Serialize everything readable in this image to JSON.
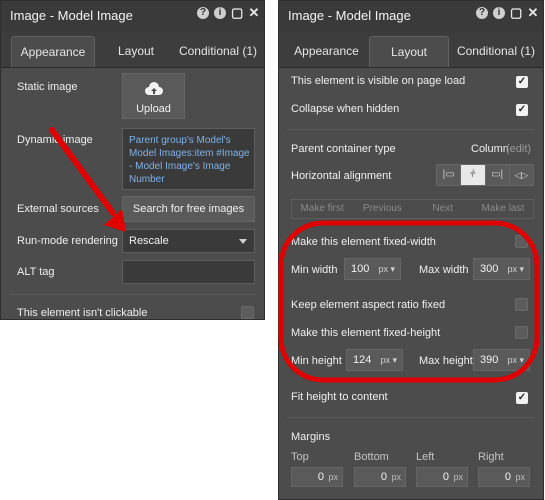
{
  "left": {
    "title": "Image - Model Image",
    "tabs": [
      "Appearance",
      "Layout",
      "Conditional (1)"
    ],
    "static_image_label": "Static image",
    "upload_label": "Upload",
    "dynamic_image_label": "Dynamic image",
    "dynamic_image_value": "Parent group's Model's Model Images:item #Image - Model Image's Image Number",
    "external_sources_label": "External sources",
    "search_button": "Search for free images",
    "runmode_label": "Run-mode rendering",
    "runmode_value": "Rescale",
    "alt_label": "ALT tag",
    "clickable_label": "This element isn't clickable"
  },
  "right": {
    "title": "Image - Model Image",
    "tabs": [
      "Appearance",
      "Layout",
      "Conditional (1)"
    ],
    "visible_label": "This element is visible on page load",
    "collapse_label": "Collapse when hidden",
    "container_label": "Parent container type",
    "container_value": "Column",
    "container_edit": "(edit)",
    "halign_label": "Horizontal alignment",
    "nav": [
      "Make first",
      "Previous",
      "Next",
      "Make last"
    ],
    "fixed_width_label": "Make this element fixed-width",
    "min_width_label": "Min width",
    "min_width_value": "100",
    "max_width_label": "Max width",
    "max_width_value": "300",
    "unit": "px",
    "aspect_label": "Keep element aspect ratio fixed",
    "fixed_height_label": "Make this element fixed-height",
    "min_height_label": "Min height",
    "min_height_value": "124",
    "max_height_label": "Max height",
    "max_height_value": "390",
    "fit_label": "Fit height to content",
    "margins_label": "Margins",
    "margin_labels": [
      "Top",
      "Bottom",
      "Left",
      "Right"
    ],
    "margin_values": [
      "0",
      "0",
      "0",
      "0"
    ]
  },
  "header_icons": [
    "help-icon",
    "info-icon",
    "comment-icon",
    "close-icon"
  ],
  "colors": {
    "panel": "#4c4c4c",
    "annotation": "#e00000"
  }
}
